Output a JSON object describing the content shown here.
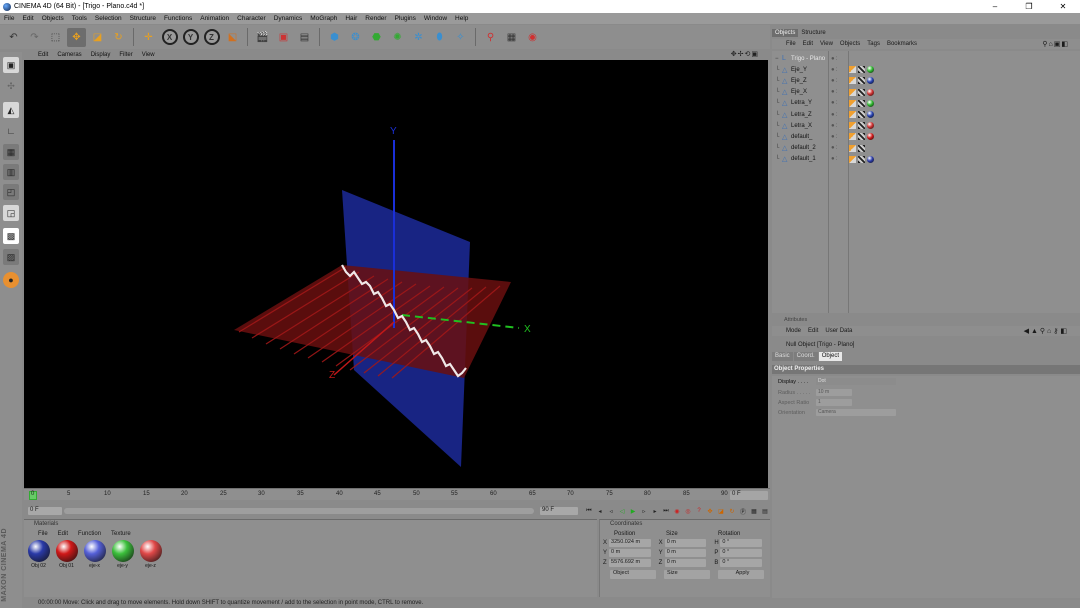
{
  "window": {
    "title": "CINEMA 4D (64 Bit) - [Trigo - Plano.c4d *]",
    "controls": [
      "–",
      "❐",
      "✕"
    ]
  },
  "menu": [
    "File",
    "Edit",
    "Objects",
    "Tools",
    "Selection",
    "Structure",
    "Functions",
    "Animation",
    "Character",
    "Dynamics",
    "MoGraph",
    "Hair",
    "Render",
    "Plugins",
    "Window",
    "Help"
  ],
  "toolbar": {
    "axis_x": "X",
    "axis_y": "Y",
    "axis_z": "Z"
  },
  "viewport": {
    "menu": [
      "Edit",
      "Cameras",
      "Display",
      "Filter",
      "View"
    ],
    "axis_labels": {
      "y": "Y",
      "x": "X",
      "z": "Z"
    }
  },
  "timeline": {
    "ticks": [
      "0",
      "5",
      "10",
      "15",
      "20",
      "25",
      "30",
      "35",
      "40",
      "45",
      "50",
      "55",
      "60",
      "65",
      "70",
      "75",
      "80",
      "85",
      "90"
    ],
    "current_frame": "0 F",
    "start_frame": "0 F",
    "end_frame": "90 F"
  },
  "materials": {
    "title": "Materials",
    "menu": [
      "File",
      "Edit",
      "Function",
      "Texture"
    ],
    "items": [
      {
        "name": "Obj 02",
        "color": "#2a3aa8"
      },
      {
        "name": "Obj 01",
        "color": "#d01818"
      },
      {
        "name": "eje-x",
        "color": "#5560d8"
      },
      {
        "name": "eje-y",
        "color": "#3cc03c"
      },
      {
        "name": "eje-z",
        "color": "#e04848"
      }
    ]
  },
  "coordinates": {
    "title": "Coordinates",
    "headers": [
      "Position",
      "Size",
      "Rotation"
    ],
    "rows": [
      {
        "axis": "X",
        "pos": "3250.024 m",
        "size_axis": "X",
        "size": "0 m",
        "rot_axis": "H",
        "rot": "0 °"
      },
      {
        "axis": "Y",
        "pos": "0 m",
        "size_axis": "Y",
        "size": "0 m",
        "rot_axis": "P",
        "rot": "0 °"
      },
      {
        "axis": "Z",
        "pos": "5576.692 m",
        "size_axis": "Z",
        "size": "0 m",
        "rot_axis": "B",
        "rot": "0 °"
      }
    ],
    "mode_select": "Object",
    "size_select": "Size",
    "apply_label": "Apply"
  },
  "status": "00:00:00 Move: Click and drag to move elements. Hold down SHIFT to quantize movement / add to the selection in point mode, CTRL to remove.",
  "objects_panel": {
    "tabs": [
      "Objects",
      "Structure"
    ],
    "menu": [
      "File",
      "Edit",
      "View",
      "Objects",
      "Tags",
      "Bookmarks"
    ],
    "items": [
      {
        "name": "Trigo - Plano",
        "tags": []
      },
      {
        "name": "Eje_Y",
        "tags": [
          "phong",
          "tex",
          "#2db82d"
        ]
      },
      {
        "name": "Eje_Z",
        "tags": [
          "phong",
          "tex",
          "#2540b0"
        ]
      },
      {
        "name": "Eje_X",
        "tags": [
          "phong",
          "tex",
          "#d03030"
        ]
      },
      {
        "name": "Letra_Y",
        "tags": [
          "phong",
          "tex",
          "#2db82d"
        ]
      },
      {
        "name": "Letra_Z",
        "tags": [
          "phong",
          "tex",
          "#2540b0"
        ]
      },
      {
        "name": "Letra_X",
        "tags": [
          "phong",
          "tex",
          "#d03030"
        ]
      },
      {
        "name": "default_",
        "tags": [
          "phong",
          "tex",
          "#d01818"
        ]
      },
      {
        "name": "default_2",
        "tags": [
          "phong",
          "tex"
        ]
      },
      {
        "name": "default_1",
        "tags": [
          "phong",
          "tex",
          "#2a3aa8"
        ]
      }
    ]
  },
  "attributes": {
    "title": "Attributes",
    "menu": [
      "Mode",
      "Edit",
      "User Data"
    ],
    "object_name": "Null Object [Trigo - Plano]",
    "tabs": [
      "Basic",
      "Coord.",
      "Object"
    ],
    "section": "Object Properties",
    "props": [
      {
        "label": "Display . . . .",
        "value": "Dot"
      },
      {
        "label": "Radius . . . . .",
        "value": "10 m"
      },
      {
        "label": "Aspect Ratio",
        "value": "1"
      },
      {
        "label": "Orientation",
        "value": "Camera"
      }
    ]
  }
}
